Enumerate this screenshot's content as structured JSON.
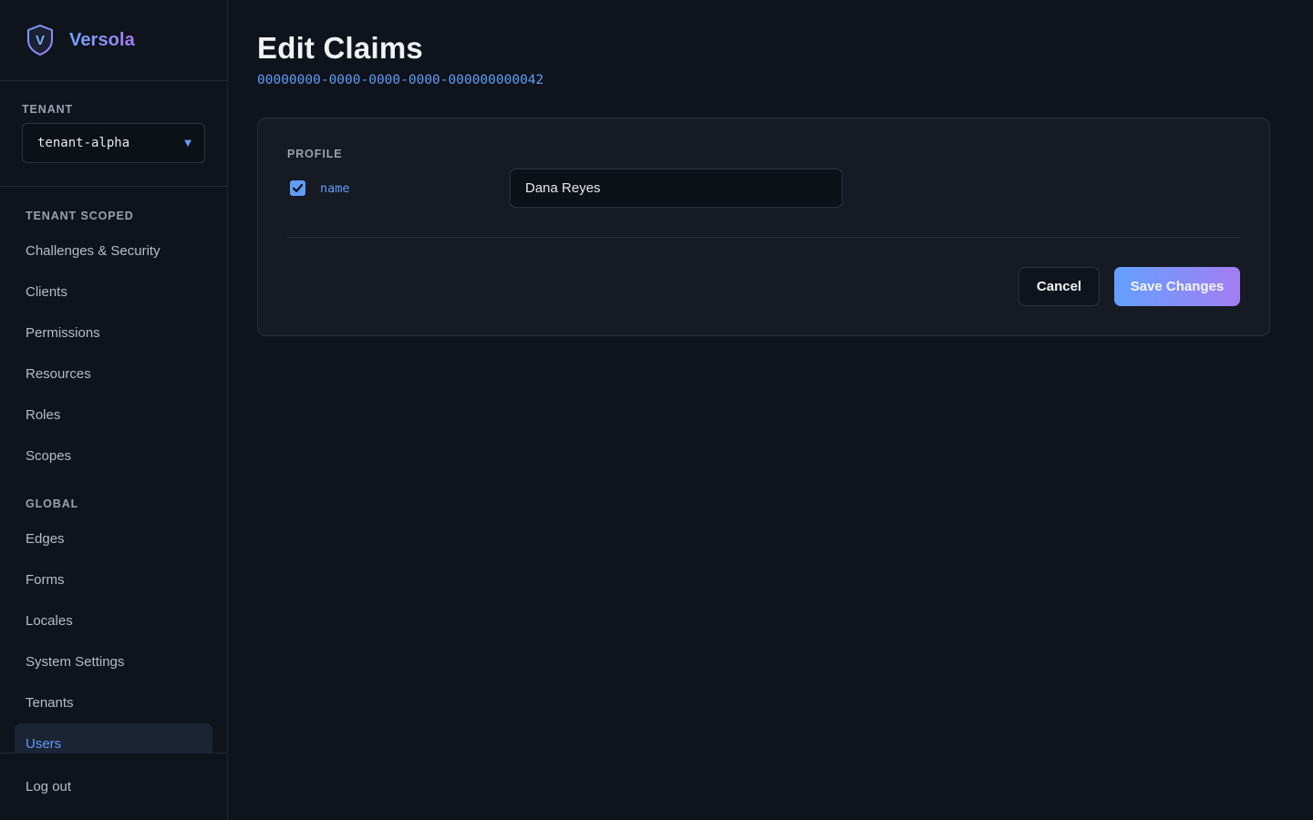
{
  "brand": {
    "name": "Versola",
    "logo_letter": "V"
  },
  "tenant": {
    "label": "Tenant",
    "selected": "tenant-alpha"
  },
  "nav": {
    "tenant_scoped_label": "Tenant Scoped",
    "tenant_scoped_items": [
      {
        "label": "Challenges & Security"
      },
      {
        "label": "Clients"
      },
      {
        "label": "Permissions"
      },
      {
        "label": "Resources"
      },
      {
        "label": "Roles"
      },
      {
        "label": "Scopes"
      }
    ],
    "global_label": "Global",
    "global_items": [
      {
        "label": "Edges"
      },
      {
        "label": "Forms"
      },
      {
        "label": "Locales"
      },
      {
        "label": "System Settings"
      },
      {
        "label": "Tenants"
      },
      {
        "label": "Users",
        "active": true
      }
    ],
    "logout_label": "Log out"
  },
  "page": {
    "title": "Edit Claims",
    "user_id": "00000000-0000-0000-0000-000000000042"
  },
  "form": {
    "section_label": "Profile",
    "claims": [
      {
        "key": "name",
        "value": "Dana Reyes",
        "checked": true
      }
    ],
    "cancel_label": "Cancel",
    "save_label": "Save Changes"
  },
  "colors": {
    "accent": "#5f9df7",
    "accent_purple": "#a47df3",
    "background": "#0f131b",
    "card": "#151a23"
  }
}
